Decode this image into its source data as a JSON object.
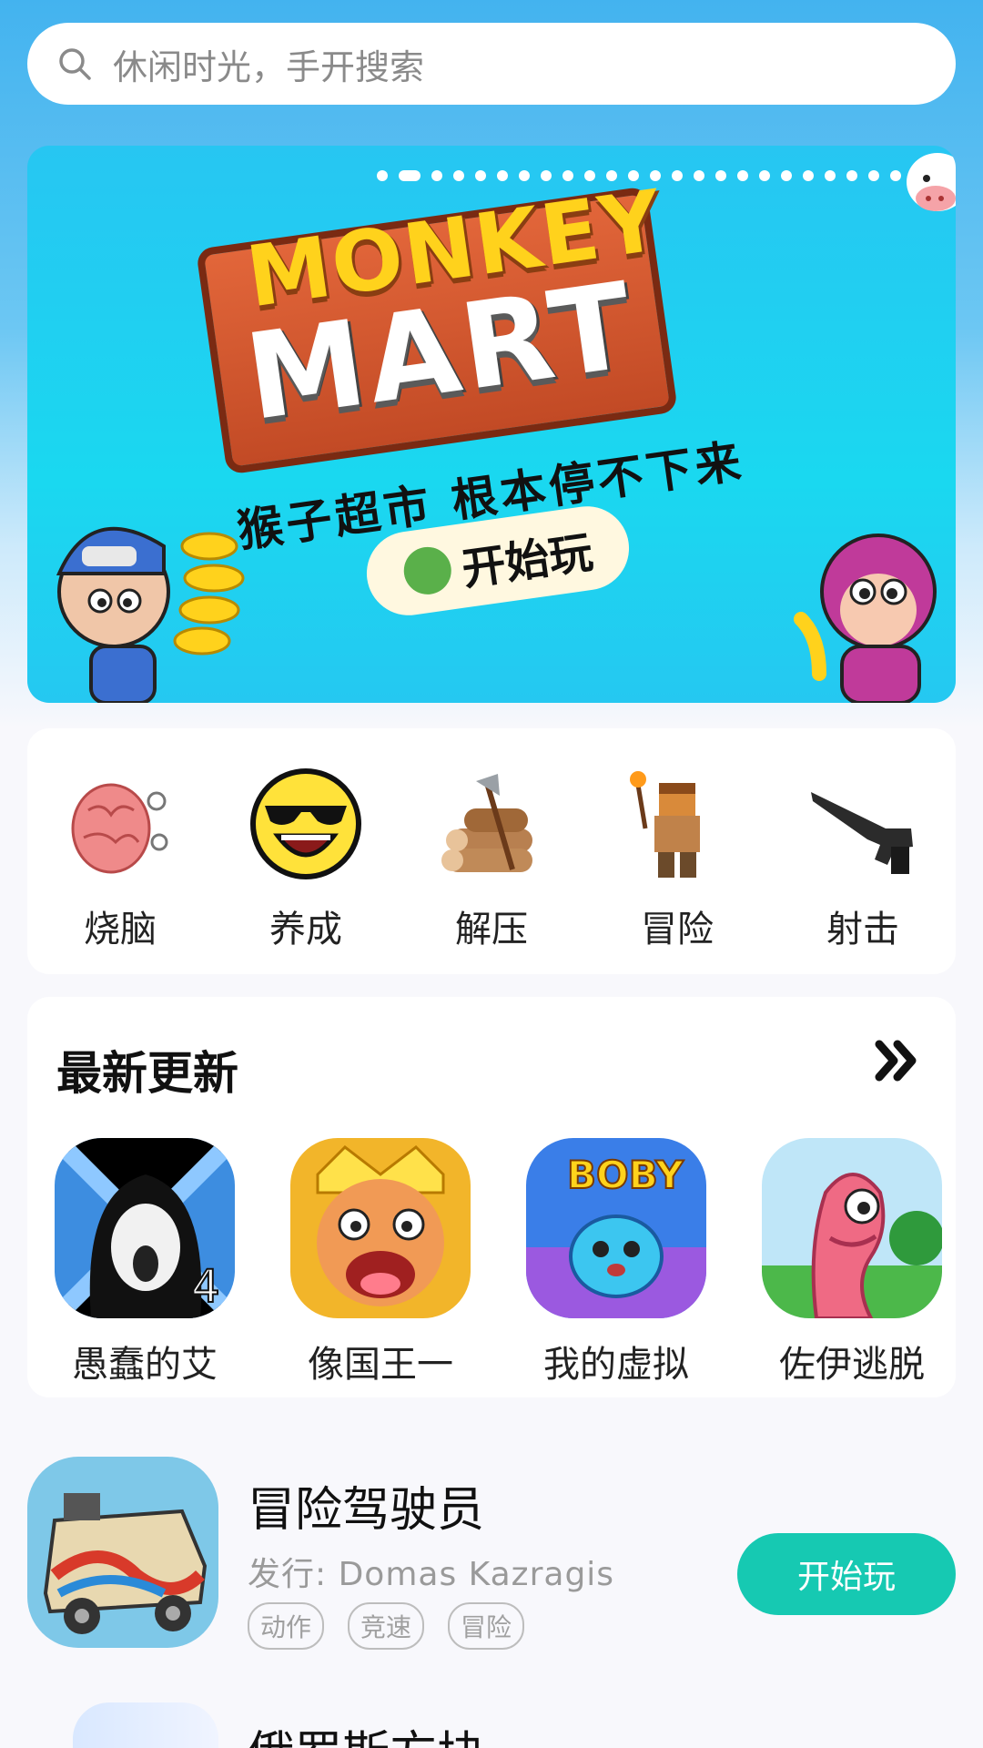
{
  "search": {
    "placeholder": "休闲时光，手开搜索"
  },
  "banner": {
    "title_line1": "MONKEY",
    "title_line2": "MART",
    "subtitle": "猴子超市 根本停不下来",
    "button_label": "开始玩",
    "page_count": 24,
    "active_page": 2
  },
  "categories": [
    {
      "label": "烧脑",
      "icon": "brain-icon"
    },
    {
      "label": "养成",
      "icon": "sunglasses-smiley-icon"
    },
    {
      "label": "解压",
      "icon": "axe-logs-icon"
    },
    {
      "label": "冒险",
      "icon": "torch-adventurer-icon"
    },
    {
      "label": "射击",
      "icon": "rifle-icon"
    }
  ],
  "newest": {
    "title": "最新更新",
    "more_icon": "double-chevron-right-icon",
    "games": [
      {
        "name": "愚蠢的艾",
        "icon": "screaming-girl-icon"
      },
      {
        "name": "像国王一",
        "icon": "angry-king-icon"
      },
      {
        "name": "我的虚拟",
        "icon": "virtual-pet-icon"
      },
      {
        "name": "佐伊逃脱",
        "icon": "pink-worm-icon"
      }
    ]
  },
  "list": [
    {
      "name": "冒险驾驶员",
      "publisher": "发行:  Domas Kazragis",
      "tags": [
        "动作",
        "竞速",
        "冒险"
      ],
      "button": "开始玩"
    },
    {
      "name": "俄罗斯方块"
    }
  ],
  "colors": {
    "accent": "#16c9b2",
    "header_blue": "#43b3ef"
  }
}
